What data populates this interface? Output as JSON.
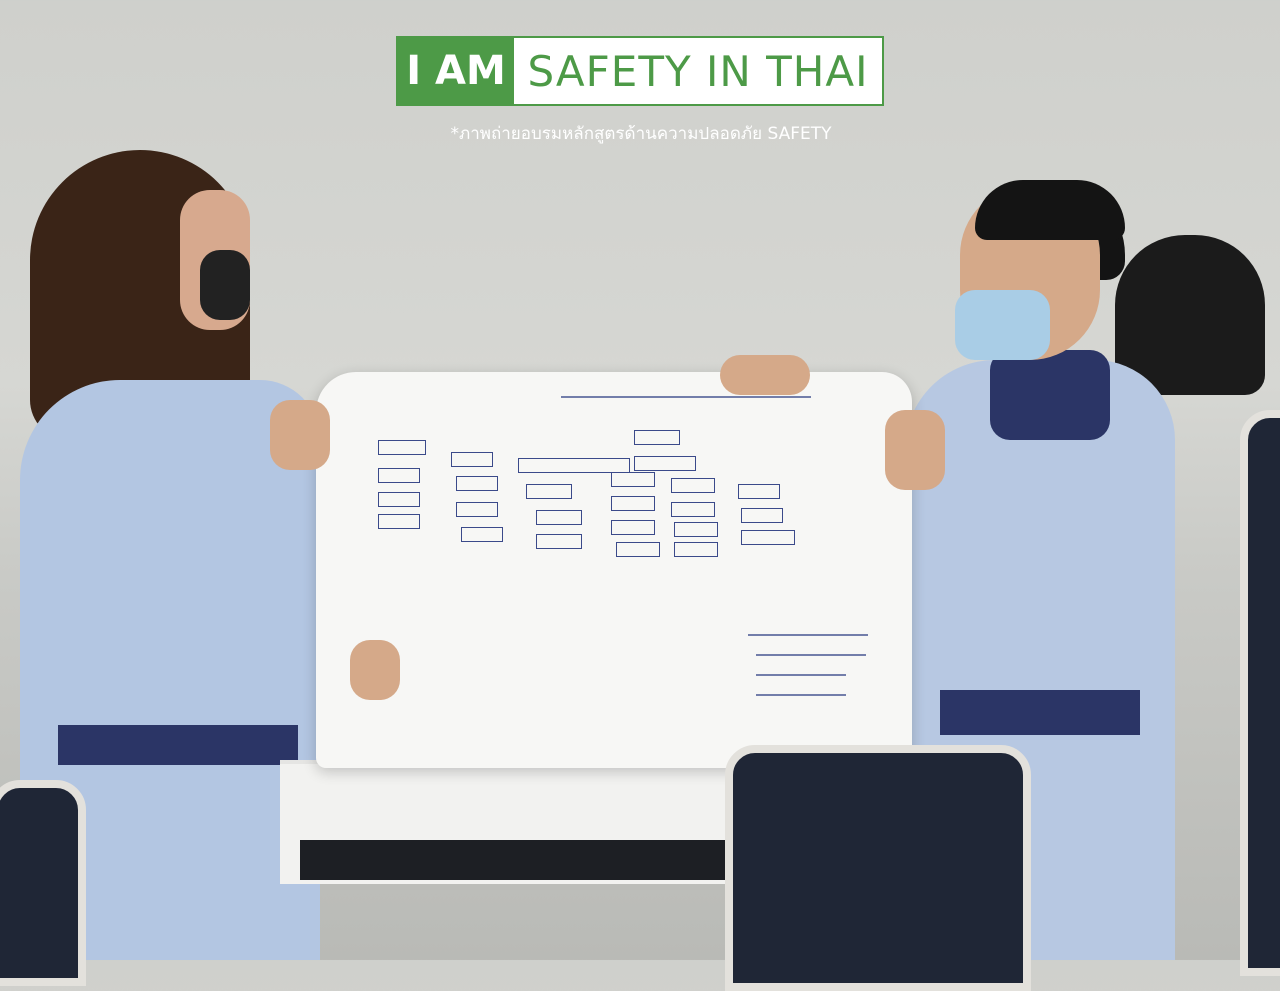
{
  "logo": {
    "left_text": "I AM",
    "right_text": "SAFETY IN THAI",
    "brand_color": "#4d9a47"
  },
  "caption": "*ภาพถ่ายอบรมหลักสูตรด้านความปลอดภัย SAFETY"
}
